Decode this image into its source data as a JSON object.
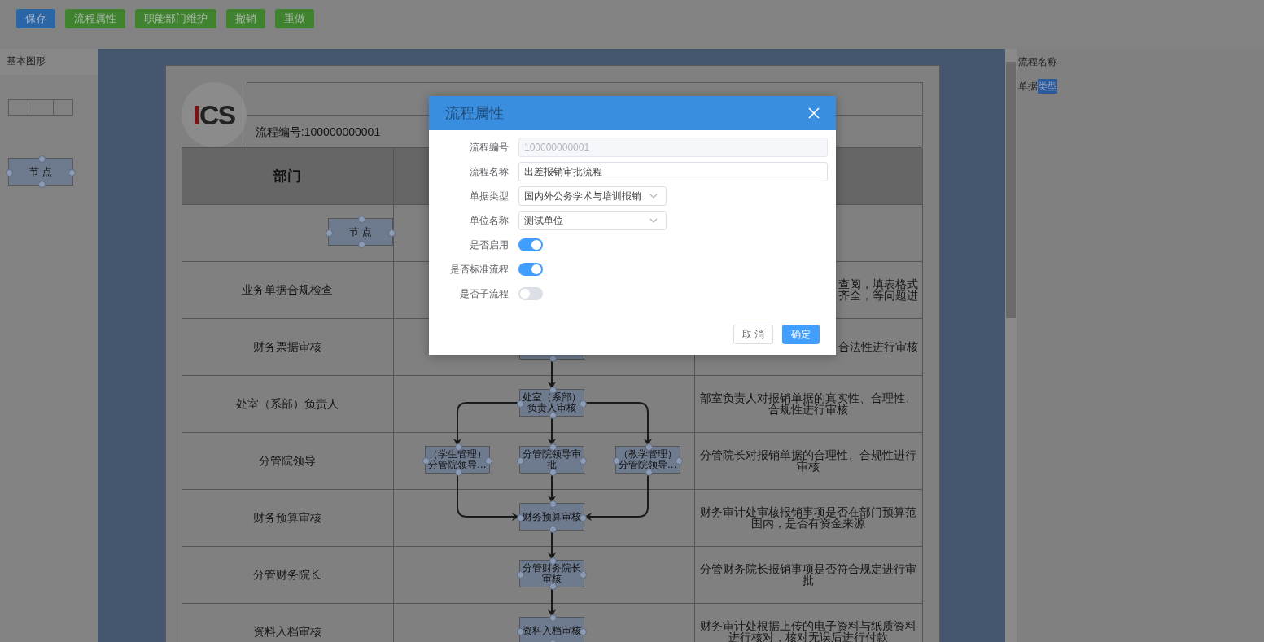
{
  "toolbar": {
    "buttons": [
      {
        "label": "保存",
        "kind": "primary"
      },
      {
        "label": "流程属性",
        "kind": "success"
      },
      {
        "label": "职能部门维护",
        "kind": "success"
      },
      {
        "label": "撤销",
        "kind": "success"
      },
      {
        "label": "重做",
        "kind": "success"
      }
    ]
  },
  "shape_panel": {
    "title": "基本图形",
    "shapes": [
      {
        "kind": "lane"
      },
      {
        "kind": "node",
        "label": "节 点"
      }
    ]
  },
  "sheet": {
    "logo": "ICS",
    "code_label": "流程编号:100000000001",
    "columns": [
      "部门"
    ],
    "rows": [
      {
        "kind": "plain"
      },
      {
        "department": "业务单据合规检查",
        "kind": "partial",
        "fragments": [
          "查阅，填表格式",
          "齐全，等问题进"
        ]
      },
      {
        "department": "财务票据审核",
        "kind": "partial",
        "fragments": [
          "合法性进行审核"
        ]
      },
      {
        "department": "处室（系部）负责人",
        "kind": "full",
        "description": "部室负责人对报销单据的真实性、合理性、合规性进行审核"
      },
      {
        "department": "分管院领导",
        "kind": "full",
        "description": "分管院长对报销单据的合理性、合规性进行审核"
      },
      {
        "department": "财务预算审核",
        "kind": "full",
        "description": "财务审计处审核报销事项是否在部门预算范围内，是否有资金来源"
      },
      {
        "department": "分管财务院长",
        "kind": "full",
        "description": "分管财务院长报销事项是否符合规定进行审批"
      },
      {
        "department": "资料入档审核",
        "kind": "full",
        "description": "财务审计处根据上传的电子资料与纸质资料进行核对，核对无误后进行付款"
      }
    ]
  },
  "diagram": {
    "nodes": [
      {
        "label": "节 点"
      },
      {
        "label": "处室（系部）负责人审核"
      },
      {
        "label": "（学生管理）分管院领导…"
      },
      {
        "label": "分管院领导审批"
      },
      {
        "label": "（教学管理）分管院领导…"
      },
      {
        "label": "财务预算审核"
      },
      {
        "label": "分管财务院长审核"
      },
      {
        "label": "资料入档审核"
      }
    ]
  },
  "property_panel": {
    "items": [
      {
        "label": "流程名称"
      },
      {
        "label": "单据",
        "selected_text": "类型"
      }
    ]
  },
  "dialog": {
    "title": "流程属性",
    "fields": [
      {
        "kind": "input",
        "label": "流程编号",
        "value": "100000000001",
        "disabled": true
      },
      {
        "kind": "input",
        "label": "流程名称",
        "value": "出差报销审批流程",
        "disabled": false
      },
      {
        "kind": "select",
        "label": "单据类型",
        "value": "国内外公务学术与培训报销"
      },
      {
        "kind": "select",
        "label": "单位名称",
        "value": "测试单位"
      },
      {
        "kind": "switch",
        "label": "是否启用",
        "on": true
      },
      {
        "kind": "switch",
        "label": "是否标准流程",
        "on": true
      },
      {
        "kind": "switch",
        "label": "是否子流程",
        "on": false
      }
    ],
    "buttons": [
      {
        "label": "取 消",
        "kind": "default"
      },
      {
        "label": "确定",
        "kind": "primary"
      }
    ]
  }
}
